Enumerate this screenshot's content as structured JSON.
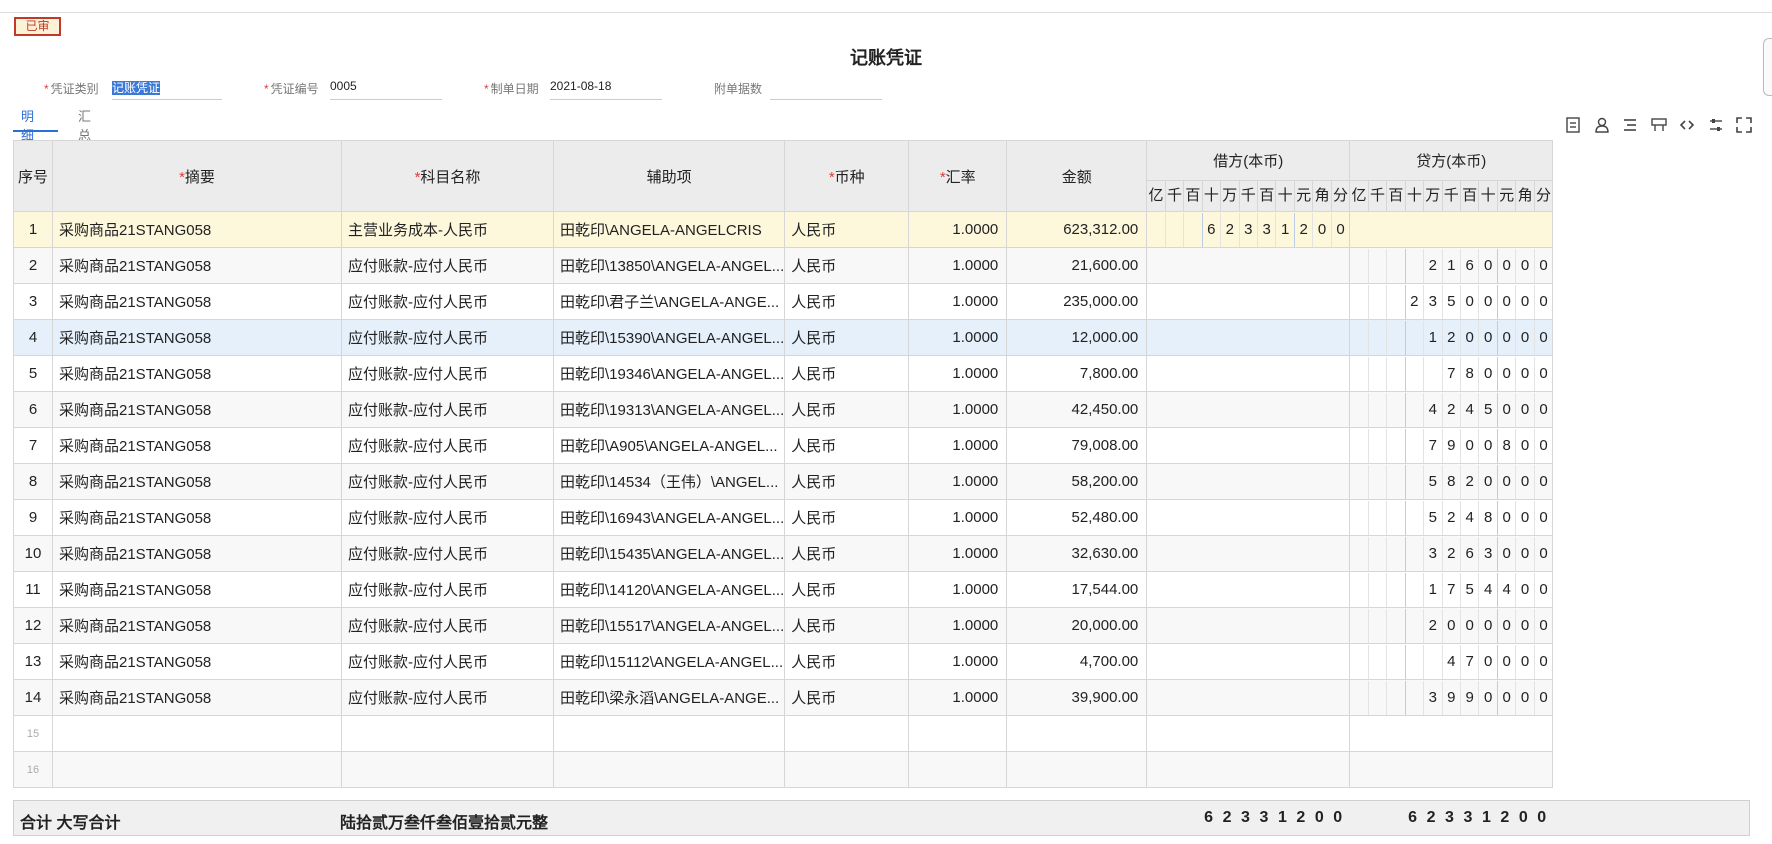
{
  "status_badge": "已审",
  "title": "记账凭证",
  "fields": {
    "category_label": "凭证类别",
    "category_value": "记账凭证",
    "number_label": "凭证编号",
    "number_value": "0005",
    "date_label": "制单日期",
    "date_value": "2021-08-18",
    "attach_label": "附单据数",
    "attach_value": ""
  },
  "tabs": [
    "明细",
    "汇总"
  ],
  "toolbar_icons": [
    "insert-row-icon",
    "lock-user-icon",
    "list-icon",
    "layout-icon",
    "link-icon",
    "adjust-icon",
    "fullscreen-icon"
  ],
  "table": {
    "headers": {
      "seq": "序号",
      "summary": "摘要",
      "account": "科目名称",
      "aux": "辅助项",
      "currency": "币种",
      "rate": "汇率",
      "amount": "金额",
      "debit": "借方(本币)",
      "credit": "贷方(本币)",
      "digit_units": [
        "亿",
        "千",
        "百",
        "十",
        "万",
        "千",
        "百",
        "十",
        "元",
        "角",
        "分"
      ]
    },
    "rows": [
      {
        "seq": "1",
        "summary": "采购商品21STANG058",
        "account": "主营业务成本-人民币",
        "aux": "田乾印\\ANGELA-ANGELCRIS",
        "currency": "人民币",
        "rate": "1.0000",
        "amount": "623,312.00",
        "debit": [
          "",
          "",
          "",
          "6",
          "2",
          "3",
          "3",
          "1",
          "2",
          "0",
          "0"
        ],
        "credit": [
          "",
          "",
          "",
          "",
          "",
          "",
          "",
          "",
          "",
          "",
          ""
        ]
      },
      {
        "seq": "2",
        "summary": "采购商品21STANG058",
        "account": "应付账款-应付人民币",
        "aux": "田乾印\\13850\\ANGELA-ANGEL...",
        "currency": "人民币",
        "rate": "1.0000",
        "amount": "21,600.00",
        "debit": [
          "",
          "",
          "",
          "",
          "",
          "",
          "",
          "",
          "",
          "",
          ""
        ],
        "credit": [
          "",
          "",
          "",
          "",
          "2",
          "1",
          "6",
          "0",
          "0",
          "0",
          "0"
        ]
      },
      {
        "seq": "3",
        "summary": "采购商品21STANG058",
        "account": "应付账款-应付人民币",
        "aux": "田乾印\\君子兰\\ANGELA-ANGE...",
        "currency": "人民币",
        "rate": "1.0000",
        "amount": "235,000.00",
        "debit": [
          "",
          "",
          "",
          "",
          "",
          "",
          "",
          "",
          "",
          "",
          ""
        ],
        "credit": [
          "",
          "",
          "",
          "2",
          "3",
          "5",
          "0",
          "0",
          "0",
          "0",
          "0"
        ]
      },
      {
        "seq": "4",
        "summary": "采购商品21STANG058",
        "account": "应付账款-应付人民币",
        "aux": "田乾印\\15390\\ANGELA-ANGEL...",
        "currency": "人民币",
        "rate": "1.0000",
        "amount": "12,000.00",
        "debit": [
          "",
          "",
          "",
          "",
          "",
          "",
          "",
          "",
          "",
          "",
          ""
        ],
        "credit": [
          "",
          "",
          "",
          "",
          "1",
          "2",
          "0",
          "0",
          "0",
          "0",
          "0"
        ]
      },
      {
        "seq": "5",
        "summary": "采购商品21STANG058",
        "account": "应付账款-应付人民币",
        "aux": "田乾印\\19346\\ANGELA-ANGEL...",
        "currency": "人民币",
        "rate": "1.0000",
        "amount": "7,800.00",
        "debit": [
          "",
          "",
          "",
          "",
          "",
          "",
          "",
          "",
          "",
          "",
          ""
        ],
        "credit": [
          "",
          "",
          "",
          "",
          "",
          "7",
          "8",
          "0",
          "0",
          "0",
          "0"
        ]
      },
      {
        "seq": "6",
        "summary": "采购商品21STANG058",
        "account": "应付账款-应付人民币",
        "aux": "田乾印\\19313\\ANGELA-ANGEL...",
        "currency": "人民币",
        "rate": "1.0000",
        "amount": "42,450.00",
        "debit": [
          "",
          "",
          "",
          "",
          "",
          "",
          "",
          "",
          "",
          "",
          ""
        ],
        "credit": [
          "",
          "",
          "",
          "",
          "4",
          "2",
          "4",
          "5",
          "0",
          "0",
          "0"
        ]
      },
      {
        "seq": "7",
        "summary": "采购商品21STANG058",
        "account": "应付账款-应付人民币",
        "aux": "田乾印\\A905\\ANGELA-ANGEL...",
        "currency": "人民币",
        "rate": "1.0000",
        "amount": "79,008.00",
        "debit": [
          "",
          "",
          "",
          "",
          "",
          "",
          "",
          "",
          "",
          "",
          ""
        ],
        "credit": [
          "",
          "",
          "",
          "",
          "7",
          "9",
          "0",
          "0",
          "8",
          "0",
          "0"
        ]
      },
      {
        "seq": "8",
        "summary": "采购商品21STANG058",
        "account": "应付账款-应付人民币",
        "aux": "田乾印\\14534（王伟）\\ANGEL...",
        "currency": "人民币",
        "rate": "1.0000",
        "amount": "58,200.00",
        "debit": [
          "",
          "",
          "",
          "",
          "",
          "",
          "",
          "",
          "",
          "",
          ""
        ],
        "credit": [
          "",
          "",
          "",
          "",
          "5",
          "8",
          "2",
          "0",
          "0",
          "0",
          "0"
        ]
      },
      {
        "seq": "9",
        "summary": "采购商品21STANG058",
        "account": "应付账款-应付人民币",
        "aux": "田乾印\\16943\\ANGELA-ANGEL...",
        "currency": "人民币",
        "rate": "1.0000",
        "amount": "52,480.00",
        "debit": [
          "",
          "",
          "",
          "",
          "",
          "",
          "",
          "",
          "",
          "",
          ""
        ],
        "credit": [
          "",
          "",
          "",
          "",
          "5",
          "2",
          "4",
          "8",
          "0",
          "0",
          "0"
        ]
      },
      {
        "seq": "10",
        "summary": "采购商品21STANG058",
        "account": "应付账款-应付人民币",
        "aux": "田乾印\\15435\\ANGELA-ANGEL...",
        "currency": "人民币",
        "rate": "1.0000",
        "amount": "32,630.00",
        "debit": [
          "",
          "",
          "",
          "",
          "",
          "",
          "",
          "",
          "",
          "",
          ""
        ],
        "credit": [
          "",
          "",
          "",
          "",
          "3",
          "2",
          "6",
          "3",
          "0",
          "0",
          "0"
        ]
      },
      {
        "seq": "11",
        "summary": "采购商品21STANG058",
        "account": "应付账款-应付人民币",
        "aux": "田乾印\\14120\\ANGELA-ANGEL...",
        "currency": "人民币",
        "rate": "1.0000",
        "amount": "17,544.00",
        "debit": [
          "",
          "",
          "",
          "",
          "",
          "",
          "",
          "",
          "",
          "",
          ""
        ],
        "credit": [
          "",
          "",
          "",
          "",
          "1",
          "7",
          "5",
          "4",
          "4",
          "0",
          "0"
        ]
      },
      {
        "seq": "12",
        "summary": "采购商品21STANG058",
        "account": "应付账款-应付人民币",
        "aux": "田乾印\\15517\\ANGELA-ANGEL...",
        "currency": "人民币",
        "rate": "1.0000",
        "amount": "20,000.00",
        "debit": [
          "",
          "",
          "",
          "",
          "",
          "",
          "",
          "",
          "",
          "",
          ""
        ],
        "credit": [
          "",
          "",
          "",
          "",
          "2",
          "0",
          "0",
          "0",
          "0",
          "0",
          "0"
        ]
      },
      {
        "seq": "13",
        "summary": "采购商品21STANG058",
        "account": "应付账款-应付人民币",
        "aux": "田乾印\\15112\\ANGELA-ANGEL...",
        "currency": "人民币",
        "rate": "1.0000",
        "amount": "4,700.00",
        "debit": [
          "",
          "",
          "",
          "",
          "",
          "",
          "",
          "",
          "",
          "",
          ""
        ],
        "credit": [
          "",
          "",
          "",
          "",
          "",
          "4",
          "7",
          "0",
          "0",
          "0",
          "0"
        ]
      },
      {
        "seq": "14",
        "summary": "采购商品21STANG058",
        "account": "应付账款-应付人民币",
        "aux": "田乾印\\梁永滔\\ANGELA-ANGE...",
        "currency": "人民币",
        "rate": "1.0000",
        "amount": "39,900.00",
        "debit": [
          "",
          "",
          "",
          "",
          "",
          "",
          "",
          "",
          "",
          "",
          ""
        ],
        "credit": [
          "",
          "",
          "",
          "",
          "3",
          "9",
          "9",
          "0",
          "0",
          "0",
          "0"
        ]
      },
      {
        "seq": "15",
        "summary": "",
        "account": "",
        "aux": "",
        "currency": "",
        "rate": "",
        "amount": "",
        "debit": [
          "",
          "",
          "",
          "",
          "",
          "",
          "",
          "",
          "",
          "",
          ""
        ],
        "credit": [
          "",
          "",
          "",
          "",
          "",
          "",
          "",
          "",
          "",
          "",
          ""
        ]
      },
      {
        "seq": "16",
        "summary": "",
        "account": "",
        "aux": "",
        "currency": "",
        "rate": "",
        "amount": "",
        "debit": [
          "",
          "",
          "",
          "",
          "",
          "",
          "",
          "",
          "",
          "",
          ""
        ],
        "credit": [
          "",
          "",
          "",
          "",
          "",
          "",
          "",
          "",
          "",
          "",
          ""
        ]
      }
    ]
  },
  "footer": {
    "total_label": "合计 大写合计",
    "amount_in_words": "陆拾贰万叁仟叁佰壹拾贰元整",
    "debit_total": [
      "",
      "",
      "",
      "6",
      "2",
      "3",
      "3",
      "1",
      "2",
      "0",
      "0"
    ],
    "credit_total": [
      "",
      "",
      "",
      "6",
      "2",
      "3",
      "3",
      "1",
      "2",
      "0",
      "0"
    ]
  },
  "colors": {
    "accent": "#2a6fd6",
    "required": "#e53935",
    "badge_border": "#c0392b",
    "row_highlight_yellow": "#fdf7dc",
    "row_highlight_blue": "#e6f0fb"
  }
}
